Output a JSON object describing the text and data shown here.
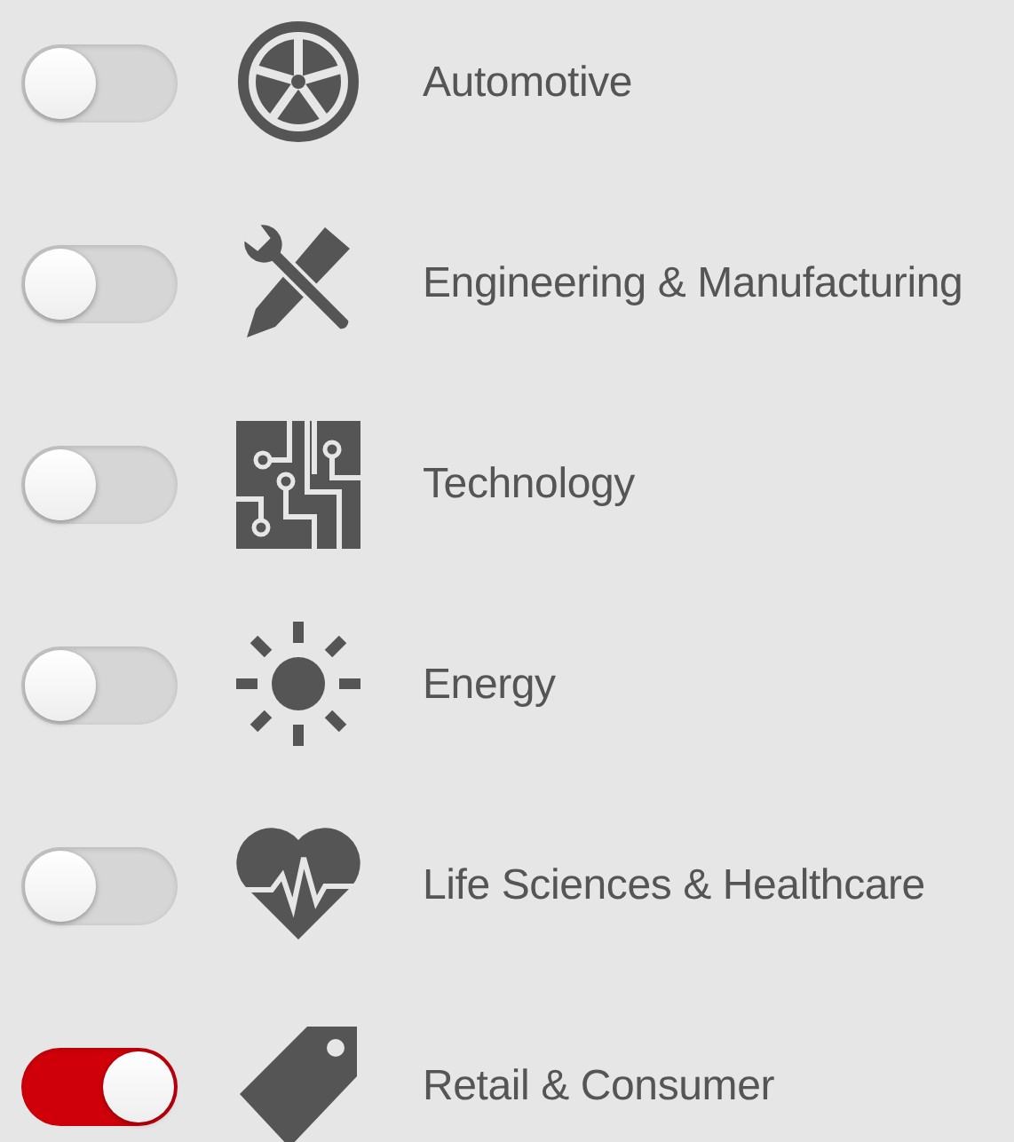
{
  "categories": [
    {
      "kind": "wheel",
      "label": "Automotive",
      "on": false
    },
    {
      "kind": "tools",
      "label": "Engineering & Manufacturing",
      "on": false
    },
    {
      "kind": "circuit",
      "label": "Technology",
      "on": false
    },
    {
      "kind": "sun",
      "label": "Energy",
      "on": false
    },
    {
      "kind": "heart",
      "label": "Life Sciences & Healthcare",
      "on": false
    },
    {
      "kind": "tag",
      "label": "Retail & Consumer",
      "on": true
    }
  ]
}
